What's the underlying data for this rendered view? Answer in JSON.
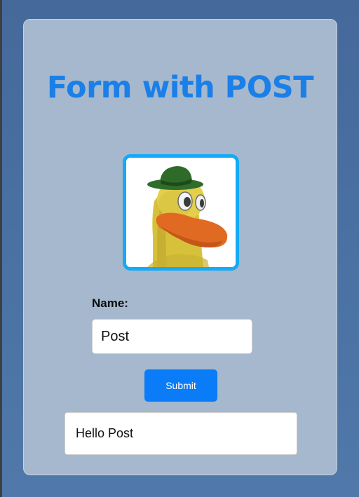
{
  "page": {
    "title": "Form with POST"
  },
  "avatar": {
    "icon": "duck-mascot-icon",
    "border_color": "#14aaf5"
  },
  "form": {
    "name_label": "Name:",
    "name_value": "Post",
    "submit_label": "Submit"
  },
  "result": {
    "message": "Hello Post"
  },
  "colors": {
    "background": "#4a73a4",
    "card": "#a5b8cd",
    "title": "#1a7fe8",
    "button": "#0a7cf7"
  }
}
